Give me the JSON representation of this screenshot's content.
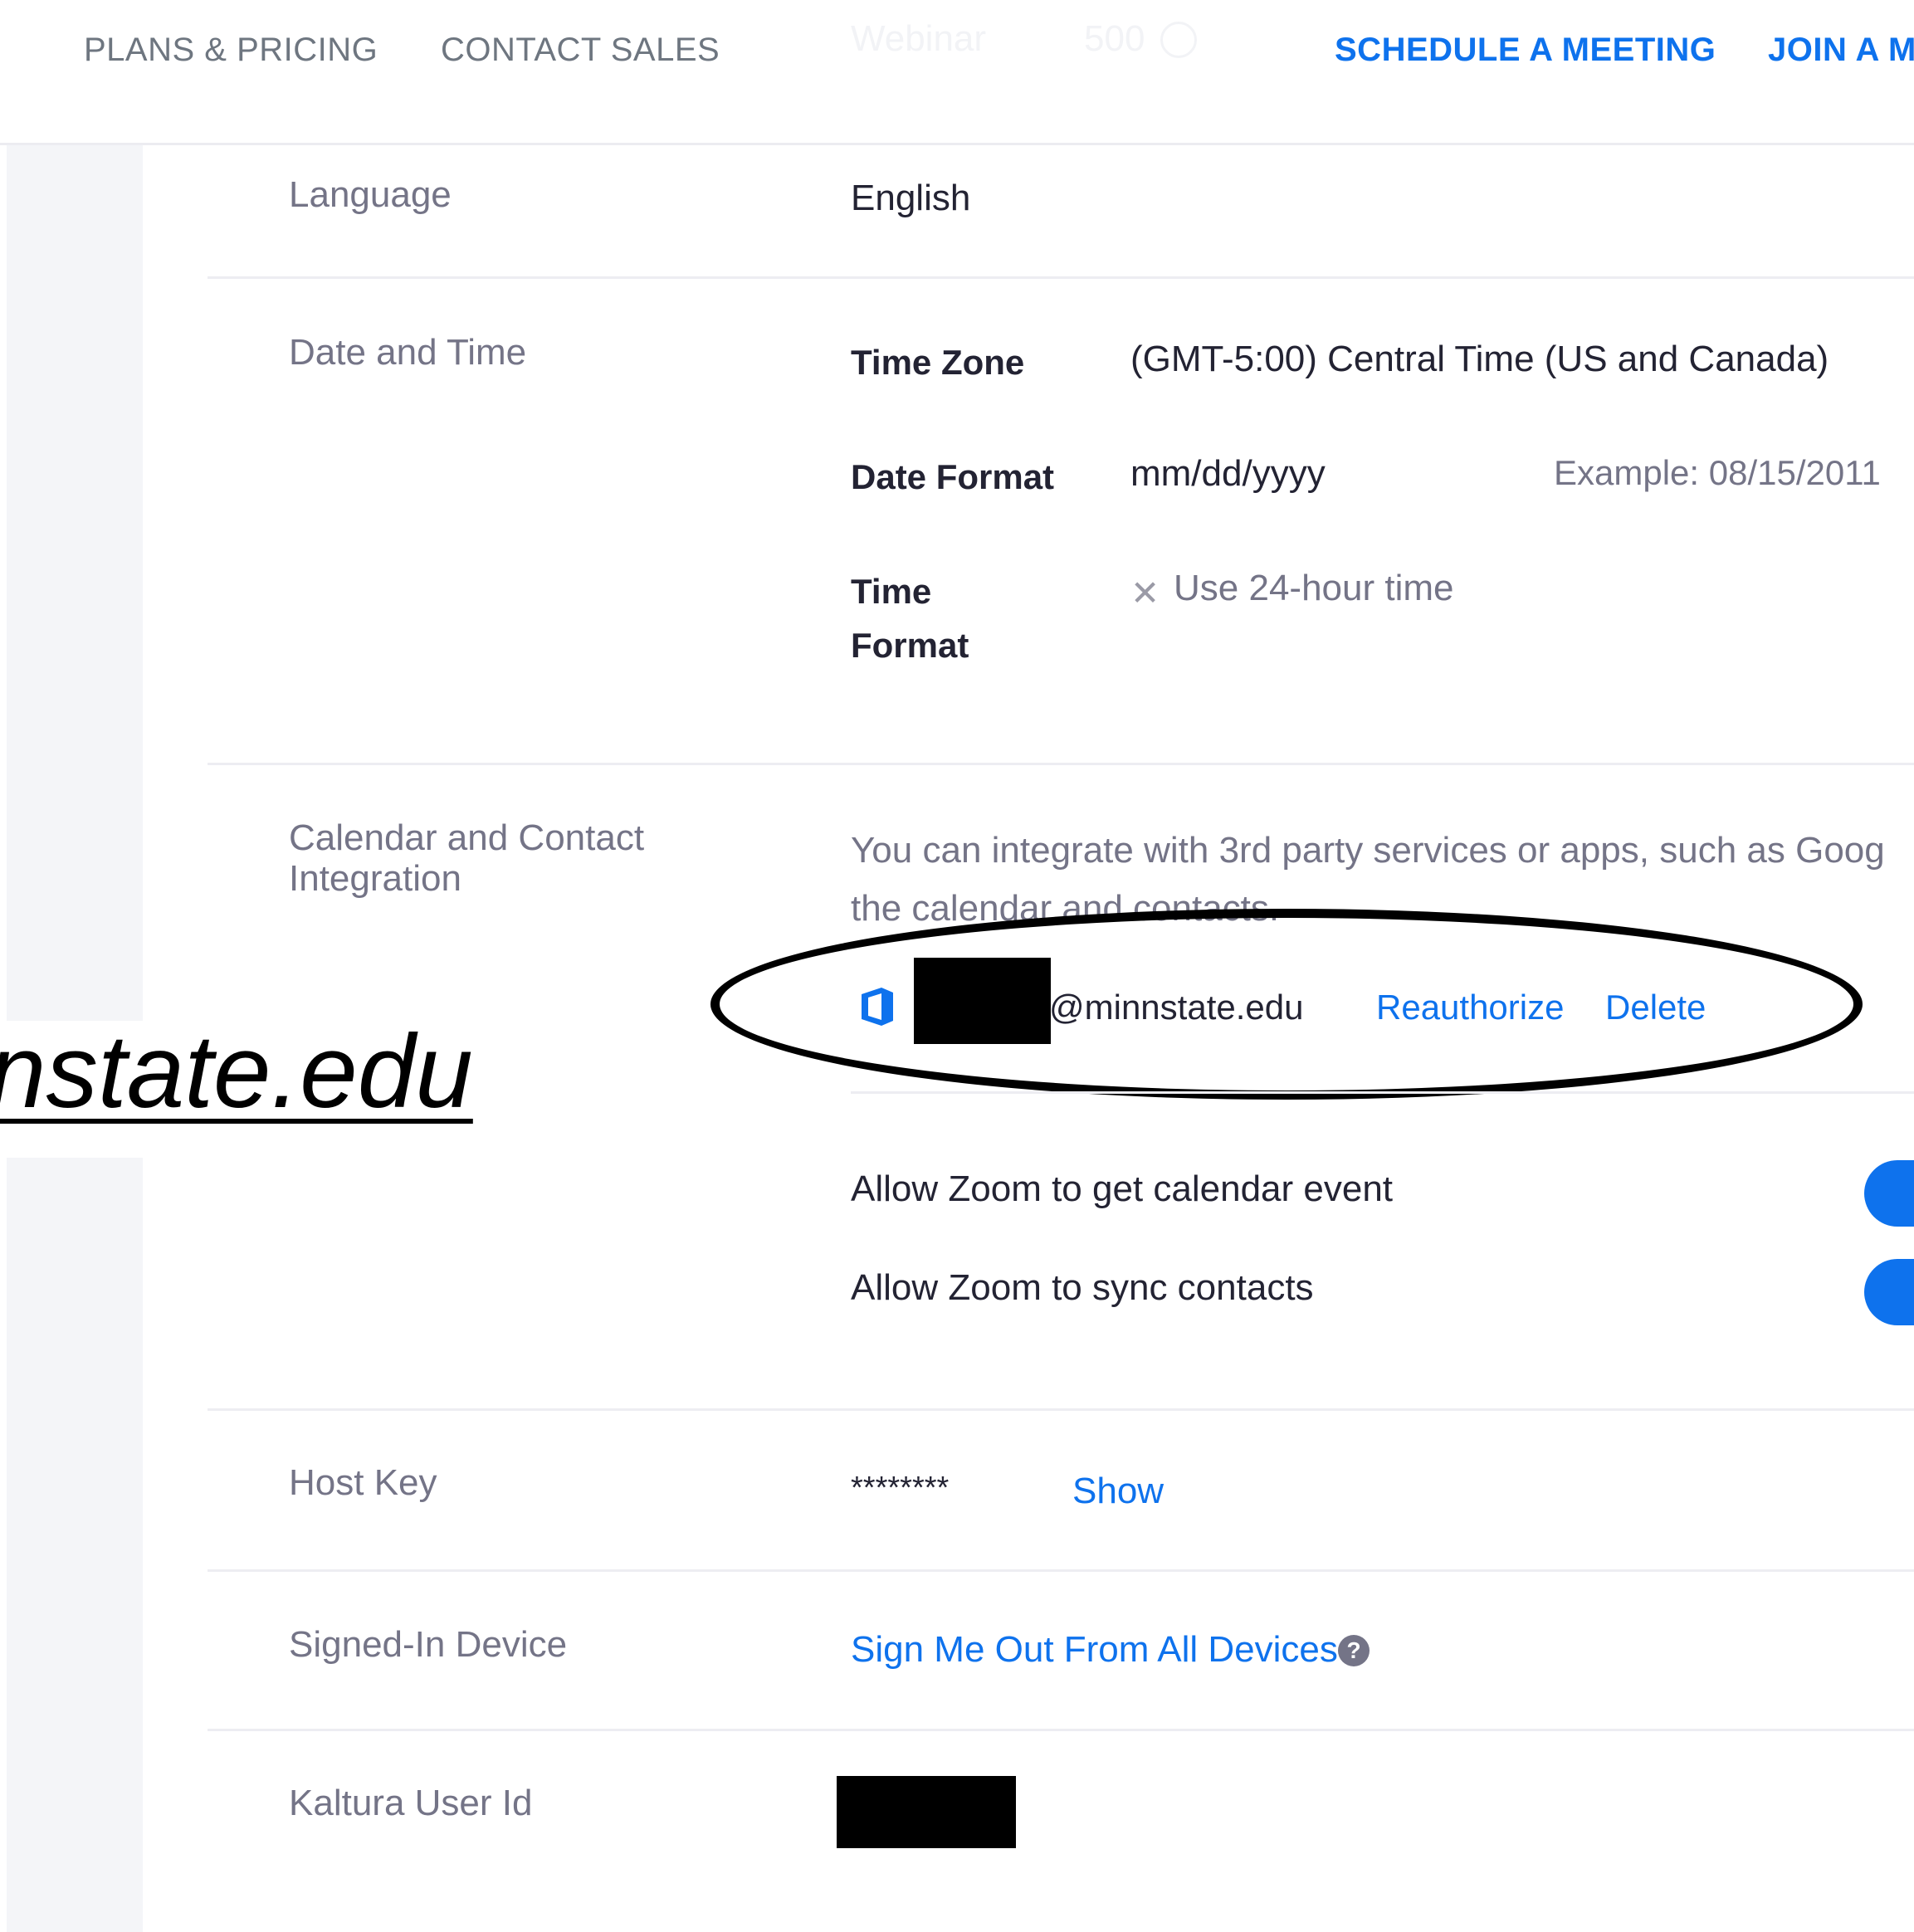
{
  "nav": {
    "plans_pricing": "PLANS & PRICING",
    "contact_sales": "CONTACT SALES",
    "ghost_label": "Webinar",
    "ghost_value": "500",
    "schedule": "SCHEDULE A MEETING",
    "join": "JOIN A M"
  },
  "language": {
    "label": "Language",
    "value": "English"
  },
  "date_time": {
    "label": "Date and Time",
    "time_zone_label": "Time Zone",
    "time_zone_value": "(GMT-5:00) Central Time (US and Canada)",
    "date_format_label": "Date Format",
    "date_format_value": "mm/dd/yyyy",
    "date_example": "Example:  08/15/2011",
    "time_format_label_1": "Time",
    "time_format_label_2": "Format",
    "time_format_value": "Use 24-hour time"
  },
  "calendar": {
    "label_1": "Calendar and Contact",
    "label_2": "Integration",
    "desc_1": "You can integrate with 3rd party services or apps, such as Goog",
    "desc_2": "the calendar and contacts.",
    "email_suffix": "@minnstate.edu",
    "reauthorize": "Reauthorize",
    "delete": "Delete",
    "allow_calendar": "Allow Zoom to get calendar event",
    "allow_contacts": "Allow Zoom to sync contacts"
  },
  "host_key": {
    "label": "Host Key",
    "value": "********",
    "show": "Show"
  },
  "signed_in": {
    "label": "Signed-In Device",
    "sign_out": "Sign Me Out From All Devices",
    "help": "?"
  },
  "kaltura": {
    "label": "Kaltura User Id"
  },
  "overlay": {
    "url_fragment": "nstate.edu"
  },
  "colors": {
    "accent": "#0e72ed",
    "label_gray": "#747487",
    "text_dark": "#232333",
    "rail_gray": "#f4f5f8"
  }
}
